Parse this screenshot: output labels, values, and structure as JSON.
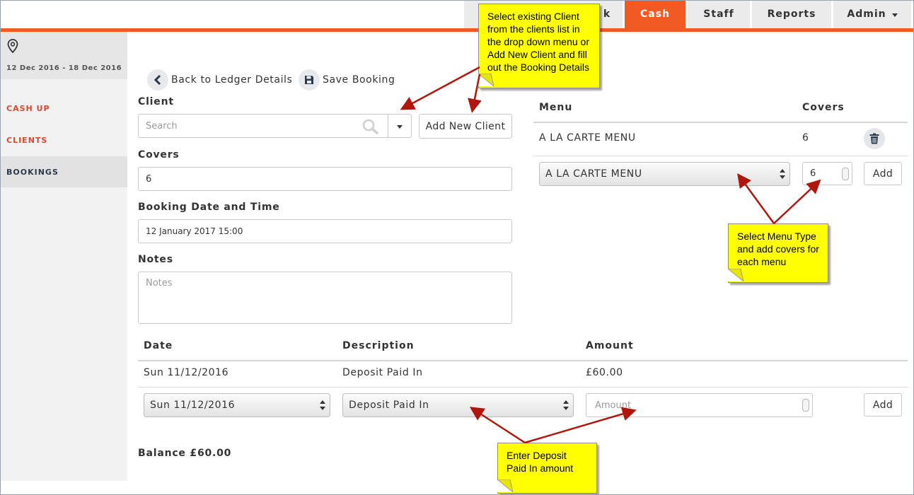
{
  "nav": {
    "tabs": [
      {
        "label": "Cash"
      },
      {
        "label": "Staff"
      },
      {
        "label": "Reports"
      },
      {
        "label": "Admin"
      }
    ],
    "hidden_tab_fragment": "k"
  },
  "sidebar": {
    "date_range": "12 Dec 2016 - 18 Dec 2016",
    "items": [
      {
        "label": "CASH UP"
      },
      {
        "label": "CLIENTS"
      },
      {
        "label": "BOOKINGS"
      }
    ]
  },
  "toolbar": {
    "back_label": "Back to Ledger Details",
    "save_label": "Save Booking"
  },
  "form": {
    "client_label": "Client",
    "client_placeholder": "Search",
    "add_client_label": "Add New Client",
    "covers_label": "Covers",
    "covers_value": "6",
    "datetime_label": "Booking Date and Time",
    "datetime_value": "12 January 2017 15:00",
    "notes_label": "Notes",
    "notes_placeholder": "Notes"
  },
  "menu_table": {
    "headers": {
      "menu": "Menu",
      "covers": "Covers"
    },
    "rows": [
      {
        "menu": "A LA CARTE MENU",
        "covers": "6"
      }
    ],
    "select_value": "A LA CARTE MENU",
    "covers_input": "6",
    "add_label": "Add"
  },
  "deposit_table": {
    "headers": {
      "date": "Date",
      "description": "Description",
      "amount": "Amount"
    },
    "rows": [
      {
        "date": "Sun 11/12/2016",
        "description": "Deposit Paid In",
        "amount": "£60.00"
      }
    ],
    "date_select": "Sun 11/12/2016",
    "description_select": "Deposit Paid In",
    "amount_placeholder": "Amount",
    "add_label": "Add"
  },
  "balance": "Balance £60.00",
  "callouts": {
    "client": "Select existing Client from the clients list in the drop down menu or Add New Client and fill out the Booking Details",
    "menu": "Select Menu Type and add covers for each menu",
    "deposit": "Enter Deposit Paid In amount"
  },
  "colors": {
    "accent": "#f15a22",
    "sidebar_link": "#e0452b",
    "callout": "#ffff00",
    "arrow": "#b0170c"
  },
  "icons": [
    "map-pin-icon",
    "chevron-left-icon",
    "floppy-disk-icon",
    "search-icon",
    "caret-down-icon",
    "trash-icon"
  ]
}
